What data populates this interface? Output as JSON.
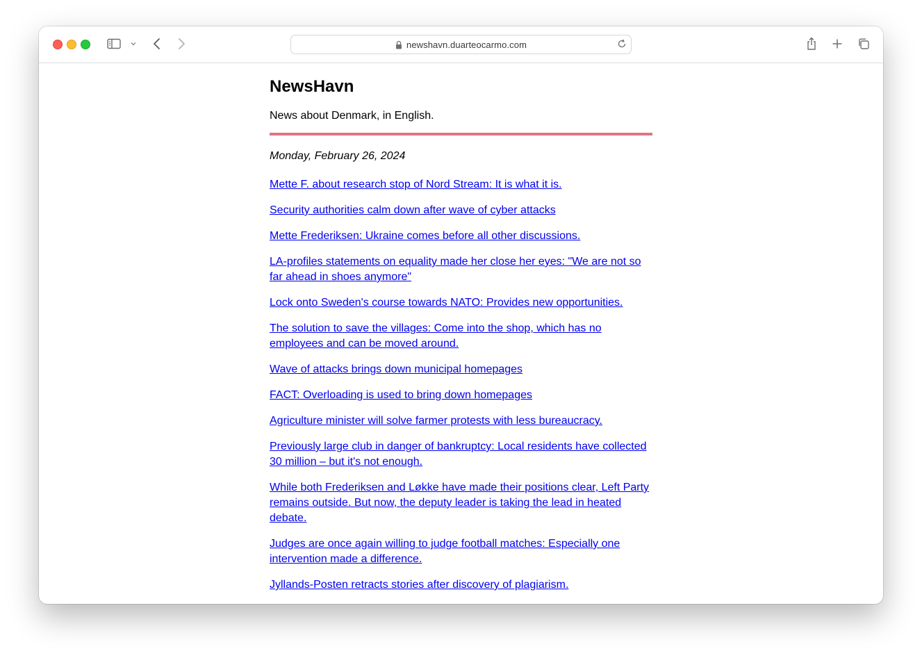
{
  "browser": {
    "url": "newshavn.duarteocarmo.com",
    "icons": [
      "sidebar-icon",
      "chevron-down-icon",
      "back-icon",
      "forward-icon",
      "lock-icon",
      "reload-icon",
      "share-icon",
      "new-tab-icon",
      "tabs-overview-icon"
    ]
  },
  "site": {
    "title": "NewsHavn",
    "tagline": "News about Denmark, in English.",
    "accent_color": "#e07583",
    "link_color": "#0000ee"
  },
  "date": "Monday, February 26, 2024",
  "articles": [
    "Mette F. about research stop of Nord Stream: It is what it is.",
    "Security authorities calm down after wave of cyber attacks",
    "Mette Frederiksen: Ukraine comes before all other discussions.",
    "LA-profiles statements on equality made her close her eyes: \"We are not so far ahead in shoes anymore\"",
    "Lock onto Sweden's course towards NATO: Provides new opportunities.",
    "The solution to save the villages: Come into the shop, which has no employees and can be moved around.",
    "Wave of attacks brings down municipal homepages",
    "FACT: Overloading is used to bring down homepages",
    "Agriculture minister will solve farmer protests with less bureaucracy.",
    "Previously large club in danger of bankruptcy: Local residents have collected 30 million – but it's not enough.",
    "While both Frederiksen and Løkke have made their positions clear, Left Party remains outside. But now, the deputy leader is taking the lead in heated debate.",
    "Judges are once again willing to judge football matches: Especially one intervention made a difference.",
    "Jyllands-Posten retracts stories after discovery of plagiarism."
  ]
}
